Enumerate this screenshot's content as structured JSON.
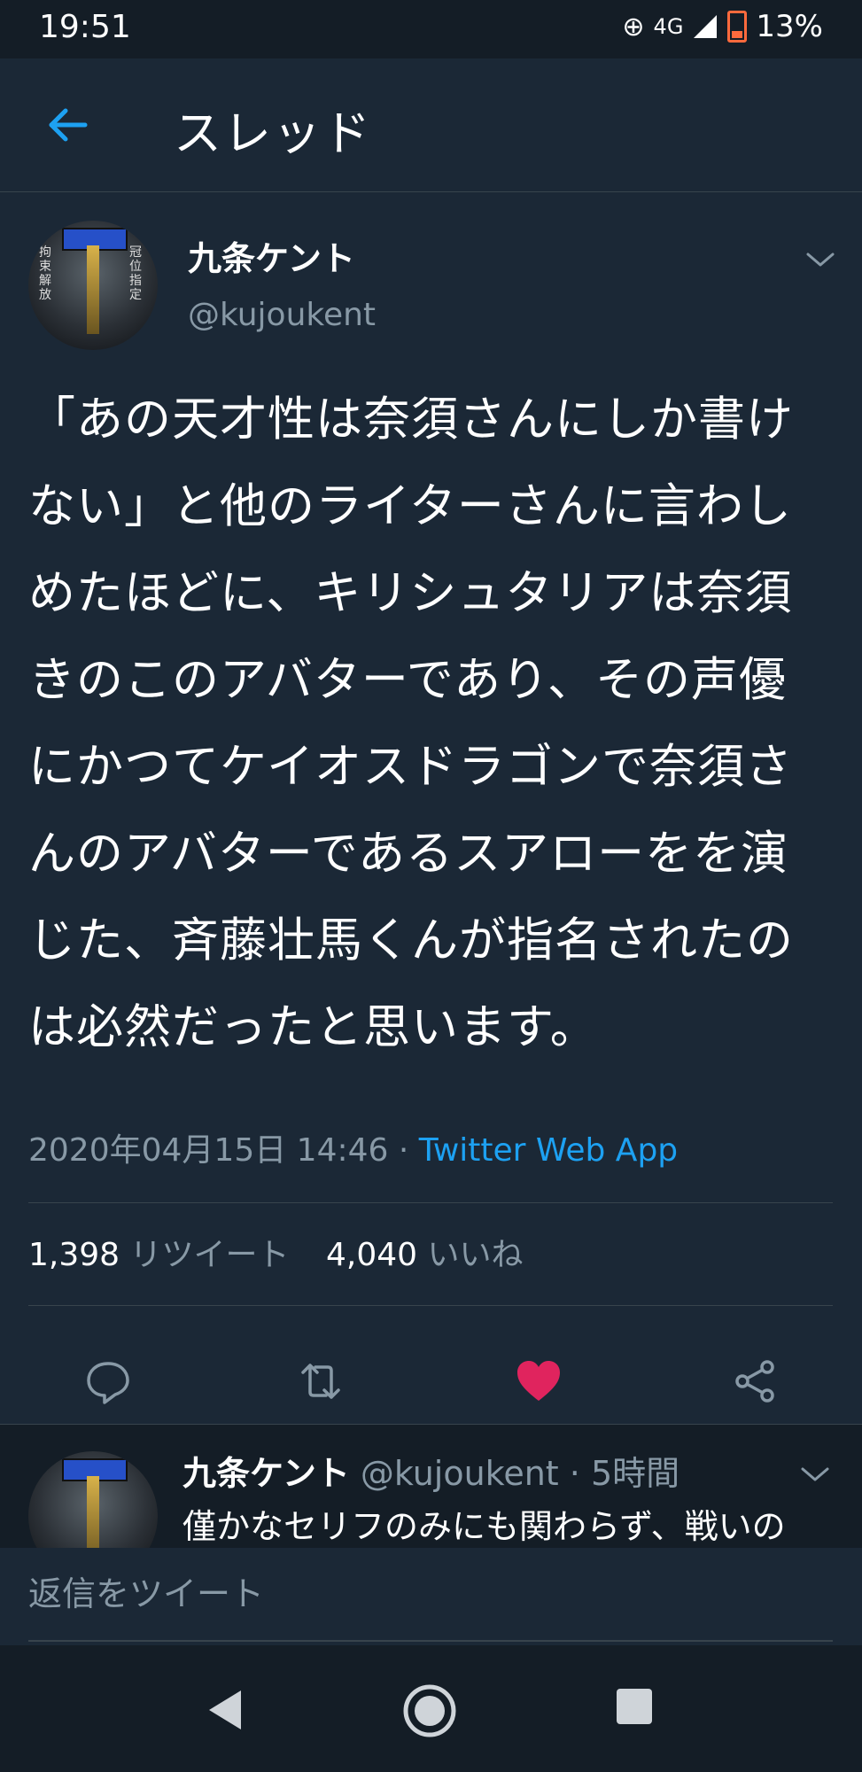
{
  "status_bar": {
    "time": "19:51",
    "network": "4G",
    "battery": "13%"
  },
  "header": {
    "title": "スレッド"
  },
  "tweet": {
    "author_name": "九条ケント",
    "author_handle": "@kujoukent",
    "text": "「あの天才性は奈須さんにしか書けない」と他のライターさんに言わしめたほどに、キリシュタリアは奈須きのこのアバターであり、その声優にかつてケイオスドラゴンで奈須さんのアバターであるスアローをを演じた、斉藤壮馬くんが指名されたのは必然だったと思います。",
    "timestamp": "2020年04月15日 14:46",
    "separator": " · ",
    "source_app": "Twitter Web App",
    "retweet_count": "1,398",
    "retweet_label": "リツイート",
    "like_count": "4,040",
    "like_label": "いいね",
    "avatar_left_text": "拘束解放",
    "avatar_right_text": "冠位指定"
  },
  "reply": {
    "author_name": "九条ケント",
    "author_handle": "@kujoukent",
    "separator": " · ",
    "time_ago": "5時間",
    "text": "僅かなセリフのみにも関わらず、戦いの"
  },
  "compose": {
    "placeholder": "返信をツイート"
  },
  "colors": {
    "background": "#141d26",
    "surface": "#1b2836",
    "accent": "#1da1f2",
    "like": "#e0245e",
    "muted": "#8899a6"
  }
}
